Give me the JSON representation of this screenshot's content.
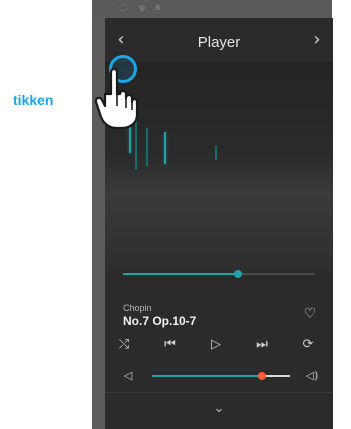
{
  "header": {
    "title": "Player",
    "back_icon": "‹",
    "forward_icon": "›"
  },
  "track": {
    "composer": "Chopin",
    "piece": "No.7 Op.10-7",
    "progress": 0.6
  },
  "icons": {
    "favorite": "♡",
    "shuffle": "⤭",
    "previous": "⏮",
    "play": "▷",
    "next": "⏭",
    "repeat": "⟳",
    "volume_low": "◁",
    "volume_high": "◁)",
    "collapse": "⌄"
  },
  "volume": {
    "level": 0.8
  },
  "annotation": {
    "tap_label": "tikken"
  },
  "colors": {
    "accent": "#1fa3a8",
    "tap": "#1aa7e8",
    "volume_thumb": "#ff5a3c"
  }
}
